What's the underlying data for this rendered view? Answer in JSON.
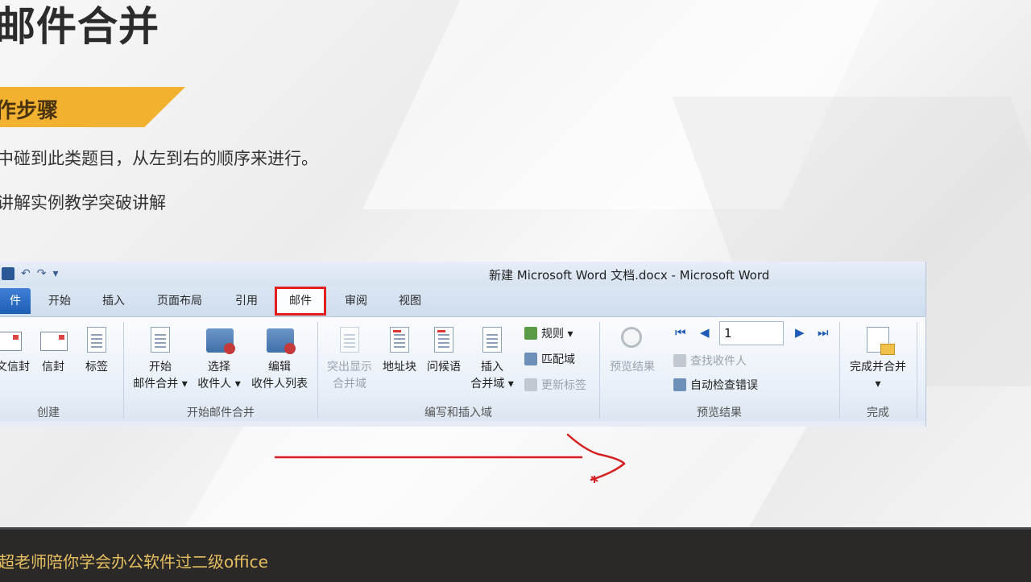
{
  "slide": {
    "title": "邮件合并",
    "section_label": "作步骤",
    "line1": "中碰到此类题目，从左到右的顺序来进行。",
    "line2": "讲解实例教学突破讲解"
  },
  "word": {
    "window_title": "新建 Microsoft Word 文档.docx - Microsoft Word",
    "qat": {
      "undo": "↶",
      "redo": "↷",
      "customize": "▾"
    },
    "file_tab": "件",
    "tabs": [
      "开始",
      "插入",
      "页面布局",
      "引用",
      "邮件",
      "审阅",
      "视图"
    ],
    "active_tab": "邮件",
    "groups": {
      "create": {
        "label": "创建",
        "buttons": [
          "中文信封",
          "信封",
          "标签"
        ]
      },
      "start_merge": {
        "label": "开始邮件合并",
        "start_top": "开始",
        "start_bottom": "邮件合并 ▾",
        "select_top": "选择",
        "select_bottom": "收件人 ▾",
        "edit_top": "编辑",
        "edit_bottom": "收件人列表"
      },
      "write_insert": {
        "label": "编写和插入域",
        "highlight_top": "突出显示",
        "highlight_bottom": "合并域",
        "address_block": "地址块",
        "greeting": "问候语",
        "insert_top": "插入",
        "insert_bottom": "合并域 ▾",
        "rules": "规则 ▾",
        "match_fields": "匹配域",
        "update_labels": "更新标签"
      },
      "preview": {
        "label": "预览结果",
        "preview_results": "预览结果",
        "record_value": "1",
        "find_recipient": "查找收件人",
        "auto_check": "自动检查错误"
      },
      "finish": {
        "label": "完成",
        "finish_top": "完成并合并",
        "finish_bottom": "▾"
      }
    }
  },
  "footer": {
    "text": "超老师陪你学会办公软件过二级office"
  },
  "colors": {
    "banner": "#f2b230",
    "highlight_box": "#e02020",
    "annotation": "#d42020",
    "footer_bg": "#2b2828",
    "footer_text": "#e6c060"
  }
}
